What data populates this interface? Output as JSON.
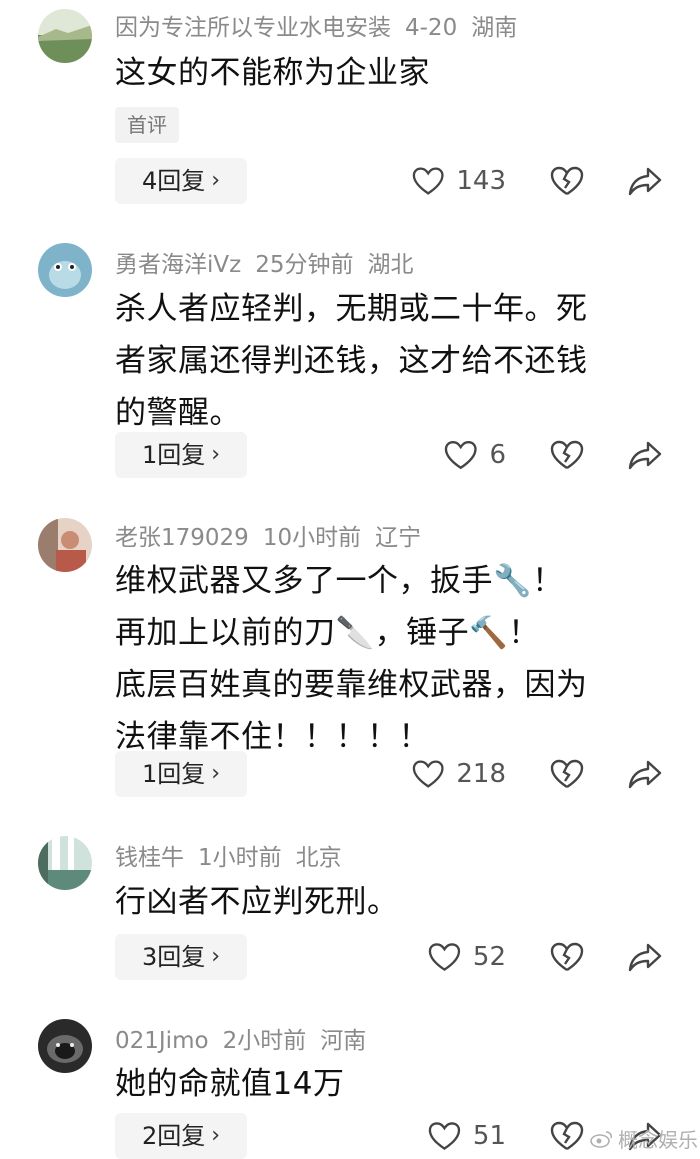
{
  "comments": [
    {
      "author": "因为专注所以专业水电安装",
      "time": "4-20",
      "location": "湖南",
      "text_lines": [
        "这女的不能称为企业家"
      ],
      "tag": "首评",
      "reply_label": "4回复",
      "likes": "143",
      "avatar_colors": [
        "#6f8f5a",
        "#a7b98a"
      ]
    },
    {
      "author": "勇者海洋iVz",
      "time": "25分钟前",
      "location": "湖北",
      "text_lines": [
        "杀人者应轻判，无期或二十年。死",
        "者家属还得判还钱，这才给不还钱",
        "的警醒。"
      ],
      "reply_label": "1回复",
      "likes": "6",
      "avatar_colors": [
        "#7fb3c9",
        "#b9dbe6"
      ]
    },
    {
      "author": "老张179029",
      "time": "10小时前",
      "location": "辽宁",
      "text_lines": [
        "维权武器又多了一个，扳手🔧！",
        "再加上以前的刀🔪，锤子🔨！",
        "底层百姓真的要靠维权武器，因为",
        "法律靠不住！！！！！"
      ],
      "reply_label": "1回复",
      "likes": "218",
      "avatar_colors": [
        "#b85a4a",
        "#e7d2c6"
      ]
    },
    {
      "author": "钱桂牛",
      "time": "1小时前",
      "location": "北京",
      "text_lines": [
        "行凶者不应判死刑。"
      ],
      "reply_label": "3回复",
      "likes": "52",
      "avatar_colors": [
        "#5d8a7a",
        "#cfe3dc"
      ]
    },
    {
      "author": "021Jimo",
      "time": "2小时前",
      "location": "河南",
      "text_lines": [
        "她的命就值14万"
      ],
      "reply_label": "2回复",
      "likes": "51",
      "avatar_colors": [
        "#2a2a2a",
        "#6a6a6a"
      ]
    }
  ],
  "watermark": "概念娱乐",
  "icons": {
    "like": "heart-outline-icon",
    "dislike": "broken-heart-icon",
    "share": "share-arrow-icon",
    "reply_chevron": "chevron-right-icon"
  }
}
